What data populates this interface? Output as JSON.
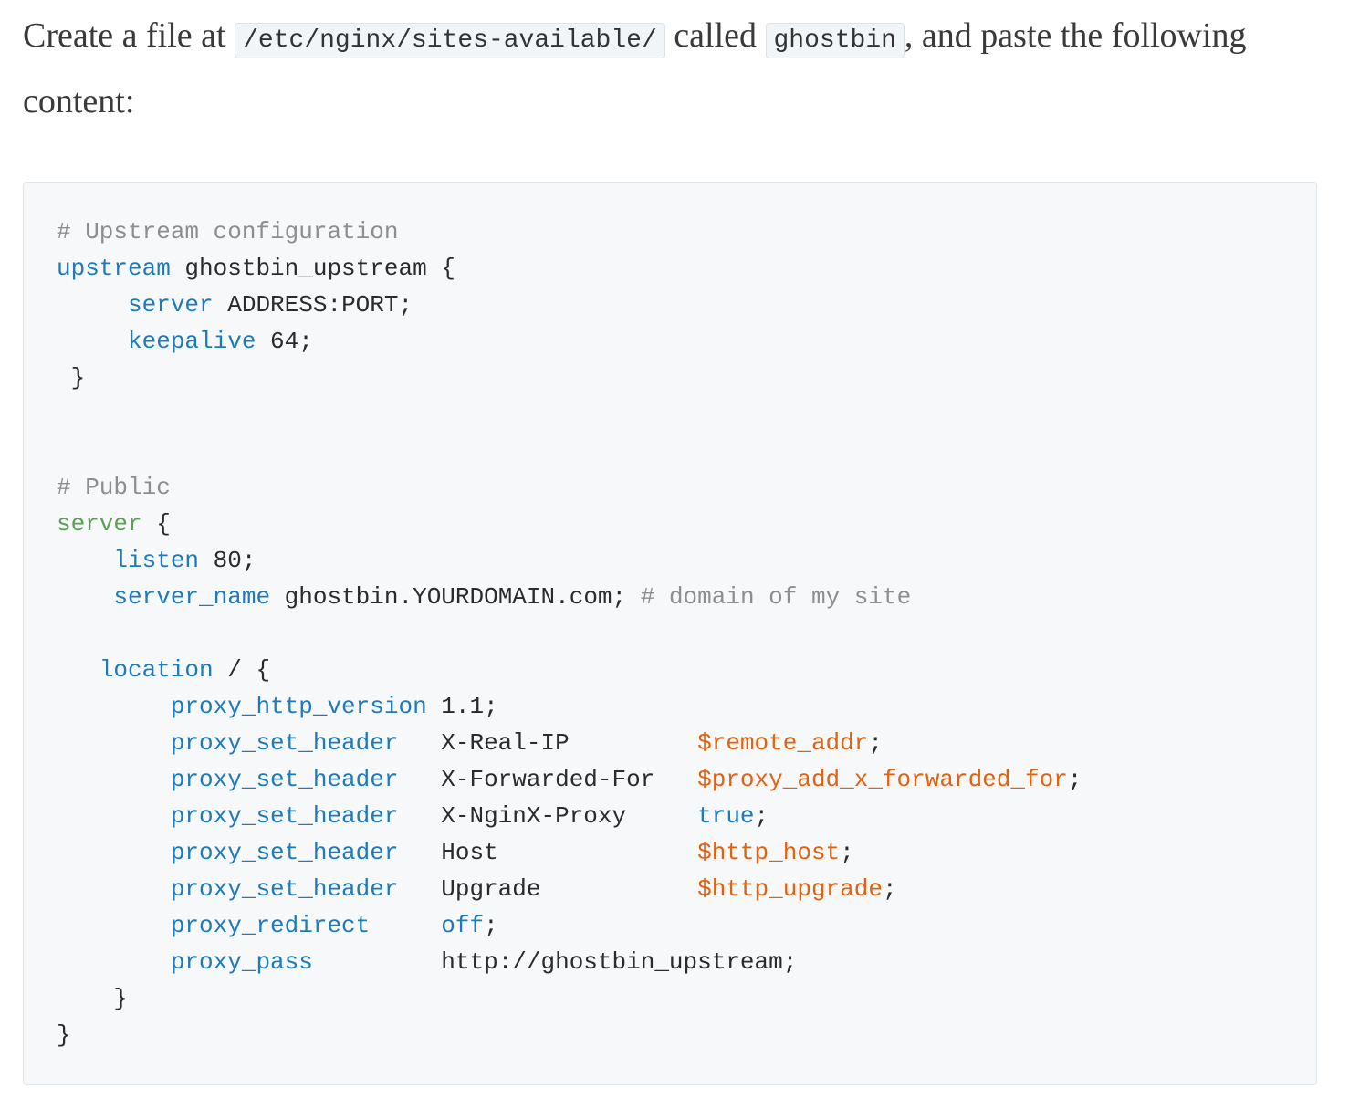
{
  "intro": {
    "text1": "Create a file at ",
    "path_code": "/etc/nginx/sites-available/",
    "text2": " called ",
    "name_code": "ghostbin",
    "text3": ", and paste the following content:"
  },
  "code": [
    [
      [
        "cm",
        "# Upstream configuration"
      ]
    ],
    [
      [
        "kw",
        "upstream"
      ],
      [
        "pl",
        " ghostbin_upstream {"
      ]
    ],
    [
      [
        "pl",
        "     "
      ],
      [
        "kw",
        "server"
      ],
      [
        "pl",
        " ADDRESS:PORT;"
      ]
    ],
    [
      [
        "pl",
        "     "
      ],
      [
        "kw",
        "keepalive"
      ],
      [
        "pl",
        " 64;"
      ]
    ],
    [
      [
        "pl",
        " }"
      ]
    ],
    [],
    [],
    [
      [
        "cm",
        "# Public"
      ]
    ],
    [
      [
        "gr",
        "server"
      ],
      [
        "pl",
        " {"
      ]
    ],
    [
      [
        "pl",
        "    "
      ],
      [
        "kw",
        "listen"
      ],
      [
        "pl",
        " 80;"
      ]
    ],
    [
      [
        "pl",
        "    "
      ],
      [
        "kw",
        "server_name"
      ],
      [
        "pl",
        " ghostbin.YOURDOMAIN.com; "
      ],
      [
        "cm",
        "# domain of my site"
      ]
    ],
    [],
    [
      [
        "pl",
        "   "
      ],
      [
        "kw",
        "location"
      ],
      [
        "pl",
        " / {"
      ]
    ],
    [
      [
        "pl",
        "        "
      ],
      [
        "kw",
        "proxy_http_version"
      ],
      [
        "pl",
        " 1.1;"
      ]
    ],
    [
      [
        "pl",
        "        "
      ],
      [
        "kw",
        "proxy_set_header"
      ],
      [
        "pl",
        "   X-Real-IP         "
      ],
      [
        "vr",
        "$remote_addr"
      ],
      [
        "pl",
        ";"
      ]
    ],
    [
      [
        "pl",
        "        "
      ],
      [
        "kw",
        "proxy_set_header"
      ],
      [
        "pl",
        "   X-Forwarded-For   "
      ],
      [
        "vr",
        "$proxy_add_x_forwarded_for"
      ],
      [
        "pl",
        ";"
      ]
    ],
    [
      [
        "pl",
        "        "
      ],
      [
        "kw",
        "proxy_set_header"
      ],
      [
        "pl",
        "   X-NginX-Proxy     "
      ],
      [
        "kw",
        "true"
      ],
      [
        "pl",
        ";"
      ]
    ],
    [
      [
        "pl",
        "        "
      ],
      [
        "kw",
        "proxy_set_header"
      ],
      [
        "pl",
        "   Host              "
      ],
      [
        "vr",
        "$http_host"
      ],
      [
        "pl",
        ";"
      ]
    ],
    [
      [
        "pl",
        "        "
      ],
      [
        "kw",
        "proxy_set_header"
      ],
      [
        "pl",
        "   Upgrade           "
      ],
      [
        "vr",
        "$http_upgrade"
      ],
      [
        "pl",
        ";"
      ]
    ],
    [
      [
        "pl",
        "        "
      ],
      [
        "kw",
        "proxy_redirect"
      ],
      [
        "pl",
        "     "
      ],
      [
        "kw",
        "off"
      ],
      [
        "pl",
        ";"
      ]
    ],
    [
      [
        "pl",
        "        "
      ],
      [
        "kw",
        "proxy_pass"
      ],
      [
        "pl",
        "         http://ghostbin_upstream;"
      ]
    ],
    [
      [
        "pl",
        "    }"
      ]
    ],
    [
      [
        "pl",
        "}"
      ]
    ]
  ]
}
